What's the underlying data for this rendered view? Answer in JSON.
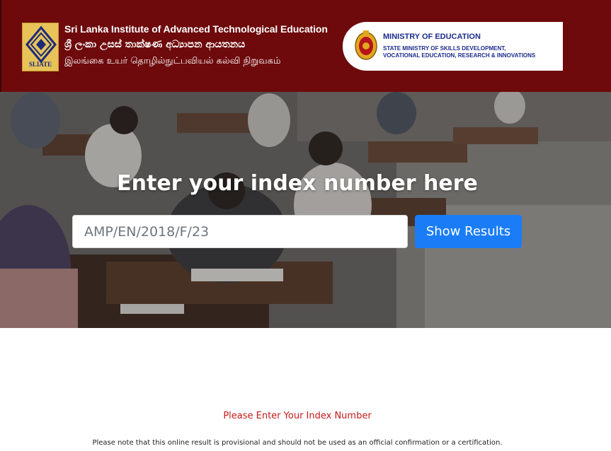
{
  "header": {
    "logo": {
      "text": "SLIATE",
      "icon": "sliate-diamond-logo"
    },
    "institute": {
      "name_en": "Sri Lanka Institute of Advanced Technological Education",
      "name_si": "ශ්‍රී ලංකා උසස් තාක්ෂණ අධ්‍යාපන ආයතනය",
      "name_ta": "இலங்கை உயர் தொழில்நுட்பவியல் கல்வி நிறுவகம்"
    },
    "ministry": {
      "emblem": "sri-lanka-emblem-icon",
      "title": "MINISTRY OF EDUCATION",
      "subtitle_line1": "STATE MINISTRY OF SKILLS DEVELOPMENT,",
      "subtitle_line2": "VOCATIONAL EDUCATION, RESEARCH & INNOVATIONS"
    }
  },
  "hero": {
    "heading": "Enter your index number here",
    "input": {
      "value": "",
      "placeholder": "AMP/EN/2018/F/23"
    },
    "button_label": "Show Results"
  },
  "messages": {
    "error": "Please Enter Your Index Number",
    "disclaimer": "Please note that this online result is provisional and should not be used as an official confirmation or a certification."
  },
  "colors": {
    "header_bg": "#6e0a0c",
    "button_bg": "#1a7df7",
    "error_text": "#c41a1a",
    "ministry_text": "#1c2c8c"
  }
}
